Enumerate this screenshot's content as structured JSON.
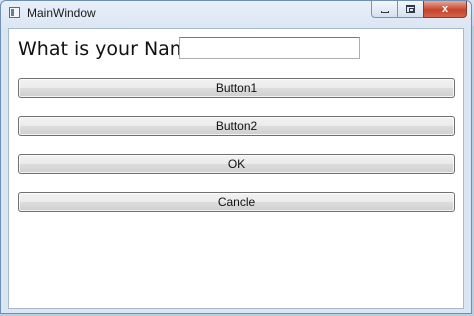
{
  "window": {
    "title": "MainWindow"
  },
  "form": {
    "prompt": "What is your Name?",
    "name_value": "",
    "name_placeholder": ""
  },
  "buttons": {
    "button1": "Button1",
    "button2": "Button2",
    "ok": "OK",
    "cancel": "Cancle"
  },
  "caption": {
    "close_glyph": "x"
  },
  "icons": [
    "app-icon",
    "minimize-icon",
    "maximize-icon",
    "close-icon"
  ],
  "colors": {
    "window_frame": "#dbe6f3",
    "close_button": "#c5452d",
    "client_background": "#ffffff"
  }
}
